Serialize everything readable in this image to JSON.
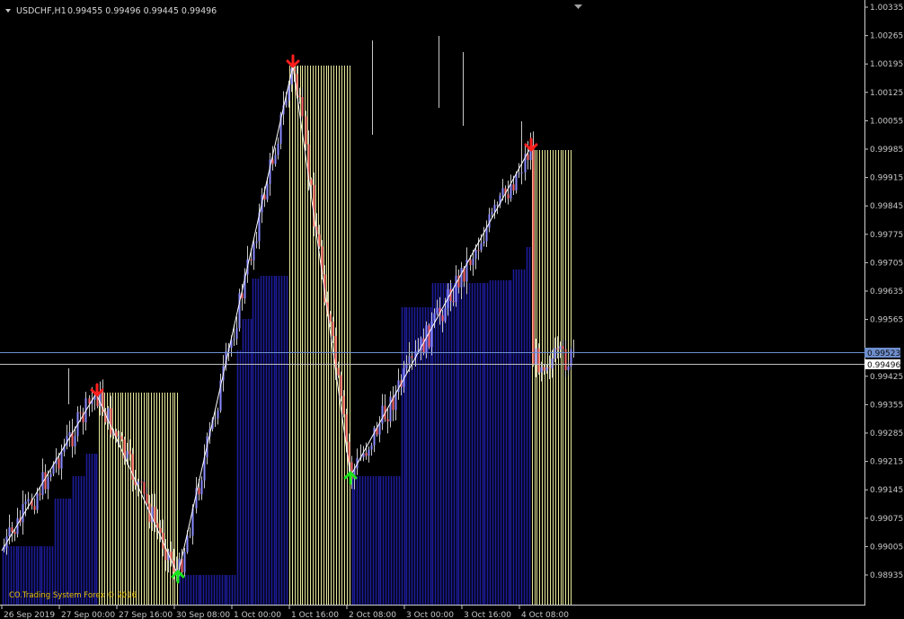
{
  "header": {
    "symbol": "USDCHF,H1",
    "ohlc": "0.99455 0.99496 0.99445 0.99496"
  },
  "watermark": "CO.Trading System Forex  © 2016",
  "price_axis": {
    "ticks": [
      "1.00335",
      "1.00265",
      "1.00195",
      "1.00125",
      "1.00055",
      "0.99985",
      "0.99915",
      "0.99845",
      "0.99775",
      "0.99705",
      "0.99635",
      "0.99565",
      "0.99425",
      "0.99355",
      "0.99285",
      "0.99215",
      "0.99145",
      "0.99075",
      "0.99005",
      "0.98935"
    ],
    "hline_price": "0.99523",
    "current_price": "0.99496"
  },
  "time_axis": {
    "ticks": [
      "26 Sep 2019",
      "27 Sep 00:00",
      "27 Sep 16:00",
      "30 Sep 08:00",
      "1 Oct 00:00",
      "1 Oct 16:00",
      "2 Oct 08:00",
      "3 Oct 00:00",
      "3 Oct 16:00",
      "4 Oct 08:00"
    ]
  },
  "colors": {
    "background": "#000000",
    "bull_candle": "#8a8aff",
    "bear_candle": "#ff6b6b",
    "wick": "#c8c8c8",
    "histogram_blue": "#1c1c9a",
    "histogram_yellow": "#e8e89a",
    "zigzag": "#ffffff",
    "arrow_down": "#ff1e1e",
    "arrow_up": "#19e619",
    "watermark": "#e6c000",
    "hline": "#6f8fcf"
  },
  "signals": [
    {
      "type": "sell",
      "icon": "arrow-down-icon"
    },
    {
      "type": "buy",
      "icon": "arrow-up-icon"
    },
    {
      "type": "sell",
      "icon": "arrow-down-icon"
    },
    {
      "type": "buy",
      "icon": "arrow-up-icon"
    },
    {
      "type": "sell",
      "icon": "arrow-down-icon"
    }
  ],
  "chart_data": {
    "type": "candlestick",
    "symbol": "USDCHF",
    "timeframe": "H1",
    "ylim": [
      0.98935,
      1.00335
    ],
    "zigzag": [
      {
        "time": "26 Sep 2019",
        "price": 0.9906
      },
      {
        "time": "27 Sep 06:00",
        "price": 0.9943
      },
      {
        "time": "30 Sep 08:00",
        "price": 0.99
      },
      {
        "time": "1 Oct 12:00",
        "price": 1.00195
      },
      {
        "time": "2 Oct 08:00",
        "price": 0.99245
      },
      {
        "time": "4 Oct 04:00",
        "price": 0.99985
      }
    ]
  }
}
